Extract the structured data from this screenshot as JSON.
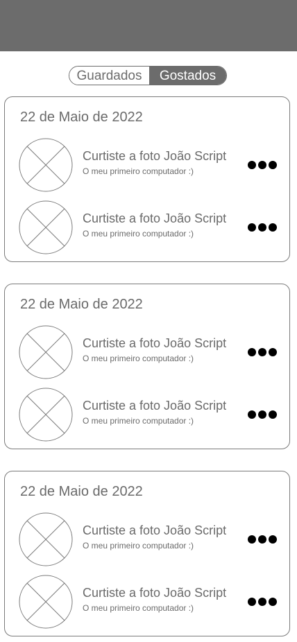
{
  "tabs": {
    "saved_label": "Guardados",
    "liked_label": "Gostados",
    "active": "Gostados"
  },
  "colors": {
    "header": "#6c6c6c",
    "accent": "#6c6c6c",
    "text": "#6a6a6a",
    "dots": "#000000"
  },
  "groups": [
    {
      "date": "22 de Maio de 2022",
      "items": [
        {
          "title": "Curtiste a foto João Script",
          "subtitle": "O meu primeiro computador :)",
          "icon": "image-placeholder-icon"
        },
        {
          "title": "Curtiste a foto João Script",
          "subtitle": "O meu primeiro computador :)",
          "icon": "image-placeholder-icon"
        }
      ]
    },
    {
      "date": "22 de Maio de 2022",
      "items": [
        {
          "title": "Curtiste a foto João Script",
          "subtitle": "O meu primeiro computador :)",
          "icon": "image-placeholder-icon"
        },
        {
          "title": "Curtiste a foto João Script",
          "subtitle": "O meu primeiro computador :)",
          "icon": "image-placeholder-icon"
        }
      ]
    },
    {
      "date": "22 de Maio de 2022",
      "items": [
        {
          "title": "Curtiste a foto João Script",
          "subtitle": "O meu primeiro computador :)",
          "icon": "image-placeholder-icon"
        },
        {
          "title": "Curtiste a foto João Script",
          "subtitle": "O meu primeiro computador :)",
          "icon": "image-placeholder-icon"
        }
      ]
    }
  ]
}
